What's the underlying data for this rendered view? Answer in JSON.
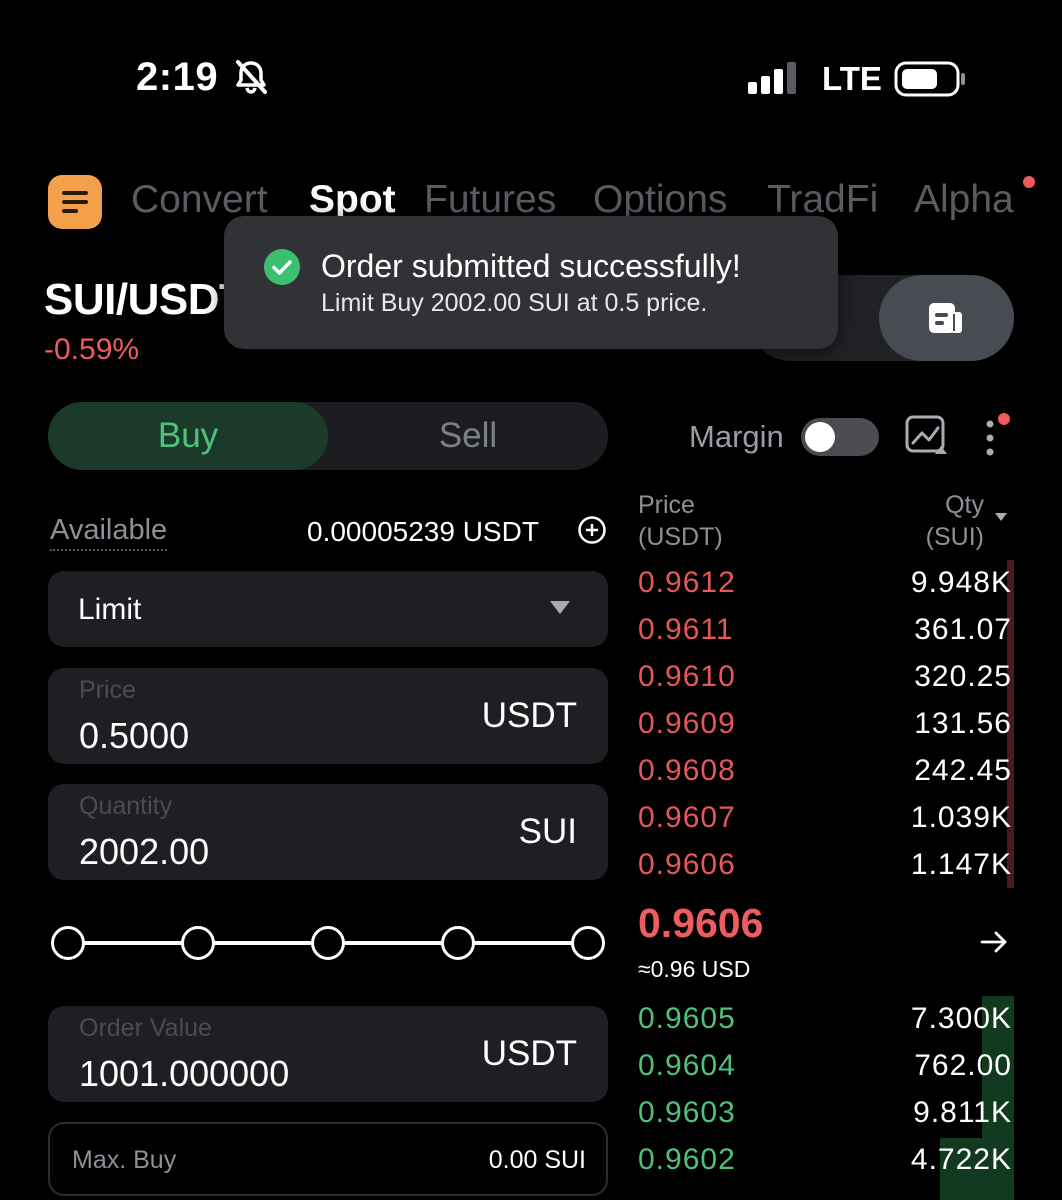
{
  "status_bar": {
    "time": "2:19",
    "network": "LTE"
  },
  "nav": {
    "tabs": [
      {
        "label": "Convert",
        "active": false
      },
      {
        "label": "Spot",
        "active": true
      },
      {
        "label": "Futures",
        "active": false
      },
      {
        "label": "Options",
        "active": false
      },
      {
        "label": "TradFi",
        "active": false
      },
      {
        "label": "Alpha",
        "active": false
      }
    ]
  },
  "pair": {
    "symbol": "SUI/USDT",
    "change": "-0.59%"
  },
  "toast": {
    "title": "Order submitted successfully!",
    "message": "Limit Buy 2002.00 SUI at 0.5 price."
  },
  "trade": {
    "buy_label": "Buy",
    "sell_label": "Sell",
    "available_label": "Available",
    "available_value": "0.00005239 USDT",
    "order_type": "Limit",
    "price_label": "Price",
    "price_value": "0.5000",
    "price_unit": "USDT",
    "quantity_label": "Quantity",
    "quantity_value": "2002.00",
    "quantity_unit": "SUI",
    "order_value_label": "Order Value",
    "order_value": "1001.000000",
    "order_value_unit": "USDT",
    "max_buy_label": "Max. Buy",
    "max_buy_value": "0.00 SUI"
  },
  "margin": {
    "label": "Margin",
    "enabled": false
  },
  "orderbook": {
    "price_header": "Price",
    "price_unit": "(USDT)",
    "qty_header": "Qty",
    "qty_unit": "(SUI)",
    "asks": [
      {
        "price": "0.9612",
        "qty": "9.948K"
      },
      {
        "price": "0.9611",
        "qty": "361.07"
      },
      {
        "price": "0.9610",
        "qty": "320.25"
      },
      {
        "price": "0.9609",
        "qty": "131.56"
      },
      {
        "price": "0.9608",
        "qty": "242.45"
      },
      {
        "price": "0.9607",
        "qty": "1.039K"
      },
      {
        "price": "0.9606",
        "qty": "1.147K"
      }
    ],
    "last_price": "0.9606",
    "last_price_usd": "≈0.96 USD",
    "bids": [
      {
        "price": "0.9605",
        "qty": "7.300K"
      },
      {
        "price": "0.9604",
        "qty": "762.00"
      },
      {
        "price": "0.9603",
        "qty": "9.811K"
      },
      {
        "price": "0.9602",
        "qty": "4.722K"
      }
    ]
  },
  "colors": {
    "background": "#000000",
    "accent_buy": "#4fc27a",
    "accent_sell": "#e5575b",
    "logo": "#f4a04a"
  },
  "icons": [
    "bell-slash-icon",
    "signal-icon",
    "battery-icon",
    "menu-icon",
    "orders-icon",
    "check-icon",
    "chart-icon",
    "more-icon",
    "plus-circle-icon",
    "dropdown-icon",
    "arrow-right-icon"
  ]
}
